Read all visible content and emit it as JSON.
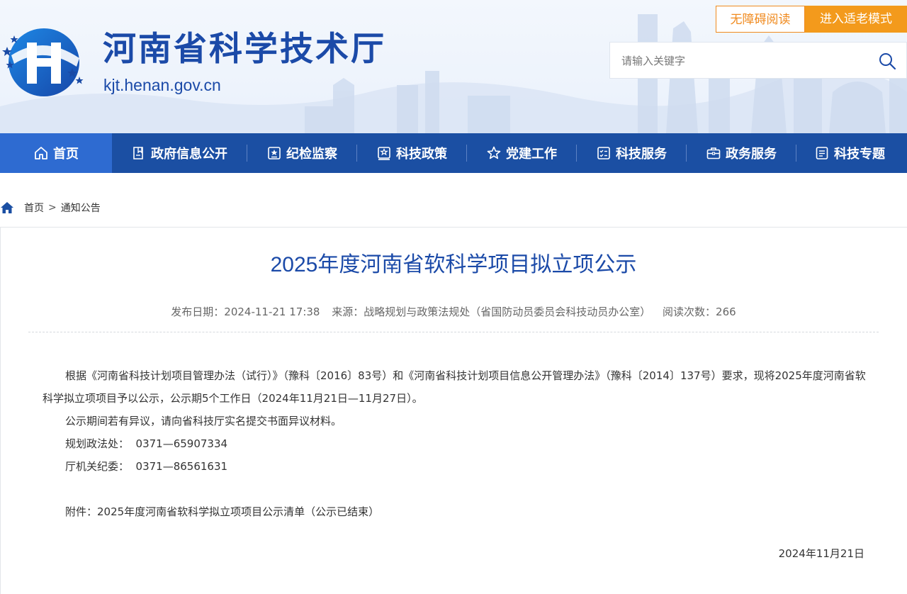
{
  "header": {
    "site_title": "河南省科学技术厅",
    "site_domain": "kjt.henan.gov.cn",
    "accessibility_button": "无障碍阅读",
    "elder_mode_button": "进入适老模式",
    "search_placeholder": "请输入关键字",
    "brand_color": "#1b4aa8",
    "accent_color": "#f39a1c"
  },
  "nav": {
    "items": [
      {
        "label": "首页",
        "icon": "home-icon"
      },
      {
        "label": "政府信息公开",
        "icon": "bookmark-doc-icon"
      },
      {
        "label": "纪检监察",
        "icon": "badge-icon"
      },
      {
        "label": "科技政策",
        "icon": "policy-icon"
      },
      {
        "label": "党建工作",
        "icon": "star-icon"
      },
      {
        "label": "科技服务",
        "icon": "checklist-icon"
      },
      {
        "label": "政务服务",
        "icon": "briefcase-icon"
      },
      {
        "label": "科技专题",
        "icon": "document-icon"
      }
    ],
    "active_index": 0
  },
  "breadcrumb": {
    "home": "首页",
    "separator": ">",
    "current": "通知公告"
  },
  "article": {
    "title": "2025年度河南省软科学项目拟立项公示",
    "publish_date": "发布日期：2024-11-21 17:38",
    "source": "来源：战略规划与政策法规处（省国防动员委员会科技动员办公室）",
    "read_count": "阅读次数：266",
    "paragraph1": "根据《河南省科技计划项目管理办法（试行）》（豫科〔2016〕83号）和《河南省科技计划项目信息公开管理办法》（豫科〔2014〕137号）要求，现将2025年度河南省软科学拟立项项目予以公示，公示期5个工作日（2024年11月21日—11月27日）。",
    "paragraph2": "公示期间若有异议，请向省科技厅实名提交书面异议材料。",
    "contact1": "规划政法处：  0371—65907334",
    "contact2": "厅机关纪委：  0371—86561631",
    "attachment": "附件：2025年度河南省软科学拟立项项目公示清单（公示已结束）",
    "date": "2024年11月21日"
  }
}
